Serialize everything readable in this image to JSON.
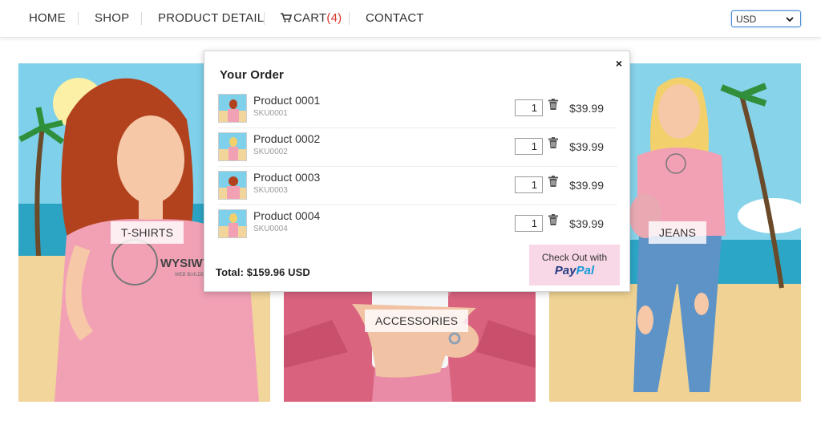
{
  "nav": {
    "items": [
      {
        "label": "HOME"
      },
      {
        "label": "SHOP"
      },
      {
        "label": "PRODUCT DETAIL"
      },
      {
        "label": "CART",
        "count": "(4)"
      },
      {
        "label": "CONTACT"
      }
    ],
    "currency": "USD"
  },
  "categories": [
    {
      "label": "T-SHIRTS"
    },
    {
      "label": "ACCESSORIES"
    },
    {
      "label": "JEANS"
    }
  ],
  "tile_art": {
    "brand_text": "WYSIWYG",
    "brand_sub": "WEB BUILDER"
  },
  "order": {
    "title": "Your Order",
    "close": "×",
    "items": [
      {
        "name": "Product 0001",
        "sku": "SKU0001",
        "qty": "1",
        "price": "$39.99"
      },
      {
        "name": "Product 0002",
        "sku": "SKU0002",
        "qty": "1",
        "price": "$39.99"
      },
      {
        "name": "Product 0003",
        "sku": "SKU0003",
        "qty": "1",
        "price": "$39.99"
      },
      {
        "name": "Product 0004",
        "sku": "SKU0004",
        "qty": "1",
        "price": "$39.99"
      }
    ],
    "total": "Total: $159.96 USD",
    "checkout_text": "Check Out with",
    "paypal_a": "Pay",
    "paypal_b": "Pal"
  },
  "colors": {
    "accent_red": "#d9342b",
    "checkout_bg": "#f8d7e6",
    "paypal_dark": "#253b80",
    "paypal_light": "#179bd7"
  },
  "icons": {
    "cart": "shopping-cart-icon",
    "trash": "trash-icon",
    "close": "close-icon",
    "chevron": "chevron-down-icon"
  }
}
